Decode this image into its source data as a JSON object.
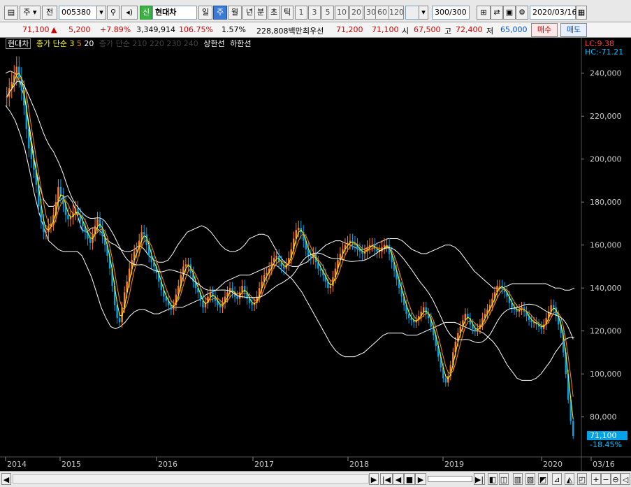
{
  "toolbar": {
    "market": "주",
    "mode": "전",
    "code": "005380",
    "badge": "신",
    "name": "현대차",
    "periods": [
      "일",
      "주",
      "월",
      "년"
    ],
    "active_period": "주",
    "intra": [
      "분",
      "초",
      "틱"
    ],
    "counts": [
      "1",
      "3",
      "5",
      "10",
      "20",
      "30",
      "60",
      "120"
    ],
    "count_value": "300/300",
    "date": "2020/03/16"
  },
  "quote": {
    "price": "71,100",
    "arrow": "▲",
    "change": "5,200",
    "change_pct": "+7.89%",
    "volume": "3,349,914",
    "vol_ratio": "106.75%",
    "turnover": "1.57%",
    "amount": "228,808백만",
    "best_label": "최우선",
    "ask": "71,200",
    "bid": "71,100",
    "open_label": "시",
    "open": "67,500",
    "high_label": "고",
    "high": "72,400",
    "low_label": "저",
    "low": "65,000",
    "buy": "매수",
    "sell": "매도"
  },
  "legend": {
    "name": "현대차",
    "ma_label": "종가 단순",
    "ma1": "3",
    "ma2": "5",
    "ma3": "20",
    "ma_long": "종가 단순 210 220 230 240",
    "upper": "상한선",
    "lower": "하한선",
    "lc": "LC:9.38",
    "hc": "HC:-71.21"
  },
  "colors": {
    "up": "#ff7f27",
    "down": "#00a2e8",
    "ma3": "#ffff00",
    "ma5": "#ff8c00",
    "ma20": "#ffffff",
    "band": "#ffffff",
    "label_bg": "#00a2e8"
  },
  "chart_data": {
    "type": "candlestick",
    "x_ticks": [
      "2014",
      "2015",
      "2016",
      "2017",
      "2018",
      "2019",
      "2020",
      "03/16"
    ],
    "y_ticks": [
      "240,000",
      "220,000",
      "200,000",
      "180,000",
      "160,000",
      "140,000",
      "120,000",
      "100,000",
      "80,000"
    ],
    "ylim": [
      62000,
      250000
    ],
    "last_price": "71,100",
    "last_change": "-18.45%",
    "weeks": 323,
    "close": [
      229000,
      233000,
      236000,
      239000,
      243000,
      238000,
      232000,
      225000,
      214000,
      205000,
      200000,
      195000,
      188000,
      178000,
      171000,
      166000,
      166000,
      169000,
      170000,
      174000,
      180000,
      187000,
      183000,
      179000,
      174000,
      172000,
      173000,
      175000,
      177000,
      174000,
      171000,
      169000,
      166000,
      163000,
      161000,
      165000,
      169000,
      172000,
      168000,
      164000,
      160000,
      155000,
      149000,
      141000,
      132000,
      126000,
      124000,
      131000,
      138000,
      143000,
      149000,
      153000,
      157000,
      158000,
      162000,
      166000,
      165000,
      160000,
      155000,
      152000,
      150000,
      147000,
      143000,
      139000,
      136000,
      134000,
      132000,
      130000,
      132000,
      137000,
      141000,
      146000,
      150000,
      151000,
      151000,
      147000,
      143000,
      140000,
      138000,
      134000,
      131000,
      133000,
      136000,
      138000,
      136000,
      134000,
      132000,
      131000,
      133000,
      136000,
      138000,
      140000,
      138000,
      136000,
      135000,
      138000,
      141000,
      138000,
      135000,
      133000,
      132000,
      133000,
      136000,
      140000,
      143000,
      146000,
      147000,
      149000,
      152000,
      154000,
      155000,
      152000,
      150000,
      149000,
      151000,
      154000,
      158000,
      163000,
      167000,
      168000,
      166000,
      162000,
      158000,
      155000,
      154000,
      156000,
      152000,
      149000,
      148000,
      146000,
      143000,
      140000,
      141000,
      145000,
      149000,
      153000,
      156000,
      158000,
      160000,
      161000,
      162000,
      161000,
      160000,
      158000,
      157000,
      156000,
      157000,
      159000,
      160000,
      160000,
      158000,
      157000,
      157000,
      159000,
      160000,
      160000,
      156000,
      152000,
      148000,
      144000,
      140000,
      136000,
      132000,
      128000,
      126000,
      125000,
      124000,
      125000,
      127000,
      129000,
      131000,
      128000,
      126000,
      122000,
      118000,
      113000,
      108000,
      103000,
      98000,
      96000,
      99000,
      104000,
      110000,
      115000,
      119000,
      122000,
      125000,
      128000,
      126000,
      123000,
      121000,
      120000,
      121000,
      123000,
      126000,
      128000,
      130000,
      132000,
      135000,
      138000,
      141000,
      141000,
      140000,
      138000,
      136000,
      133000,
      131000,
      130000,
      129000,
      130000,
      131000,
      129000,
      127000,
      125000,
      124000,
      124000,
      123000,
      122000,
      121000,
      123000,
      126000,
      129000,
      132000,
      131000,
      127000,
      123000,
      119000,
      110000,
      100000,
      88000,
      78000,
      71100
    ],
    "ma_upper": [
      240000,
      241000,
      240000,
      236000,
      228000,
      215000,
      200000,
      188000,
      181000,
      178000,
      178000,
      180000,
      182000,
      183000,
      180000,
      174000,
      167000,
      166000,
      168000,
      168000,
      166000,
      163000,
      161000,
      160000,
      158000,
      157000,
      157000,
      158000,
      160000,
      158000,
      155000,
      153000,
      152000,
      152000,
      153000,
      156000,
      160000,
      163000,
      166000,
      167000,
      168000,
      169000,
      168000,
      166000,
      163000,
      160000,
      158000,
      157000,
      157000,
      158000,
      160000,
      163000,
      164000,
      165000,
      165000,
      164000,
      160000,
      156000,
      153000,
      151000,
      150000,
      150000,
      151000,
      152000,
      154000,
      156000,
      158000,
      160000,
      161000,
      162000,
      162000,
      161000,
      160000,
      159000,
      158000,
      158000,
      159000,
      160000,
      161000,
      162000,
      163000,
      163000,
      163000,
      162000,
      160000,
      158000,
      157000,
      156000,
      156000,
      157000,
      158000,
      159000,
      160000,
      160000,
      159000,
      157000,
      154000,
      151000,
      148000,
      146000,
      144000,
      142000,
      140000,
      140000,
      140000,
      141000,
      142000,
      142000,
      142000,
      142000,
      142000,
      142000,
      142000,
      142000,
      141000,
      140000,
      140000,
      139000,
      139000,
      140000
    ],
    "ma_lower": [
      225000,
      222000,
      218000,
      212000,
      205000,
      195000,
      184000,
      175000,
      168000,
      162000,
      160000,
      158000,
      157000,
      157000,
      157000,
      157000,
      155000,
      150000,
      145000,
      138000,
      131000,
      126000,
      122000,
      121000,
      122000,
      124000,
      127000,
      129000,
      130000,
      130000,
      129000,
      128000,
      128000,
      129000,
      130000,
      131000,
      131000,
      131000,
      132000,
      133000,
      134000,
      135000,
      137000,
      138000,
      139000,
      141000,
      143000,
      144000,
      145000,
      146000,
      146000,
      146000,
      147000,
      148000,
      149000,
      150000,
      151000,
      150000,
      148000,
      146000,
      144000,
      141000,
      138000,
      134000,
      130000,
      126000,
      122000,
      118000,
      114000,
      111000,
      109000,
      108000,
      108000,
      108000,
      109000,
      110000,
      112000,
      114000,
      116000,
      118000,
      119000,
      119000,
      119000,
      119000,
      118000,
      118000,
      118000,
      119000,
      120000,
      121000,
      122000,
      123000,
      124000,
      124000,
      124000,
      123000,
      122000,
      121000,
      120000,
      120000,
      119000,
      117000,
      115000,
      112000,
      108000,
      104000,
      101000,
      98000,
      97000,
      97000,
      97000,
      98000,
      100000,
      103000,
      106000,
      110000,
      113000,
      116000,
      117000,
      117000
    ]
  },
  "scrollbar": {
    "arrows": [
      "◀",
      "▶"
    ],
    "buttons": [
      "|◀",
      "◀",
      "■",
      "▶",
      "▶|"
    ],
    "tools": [
      "+",
      "−",
      "⊖",
      "◁"
    ]
  }
}
